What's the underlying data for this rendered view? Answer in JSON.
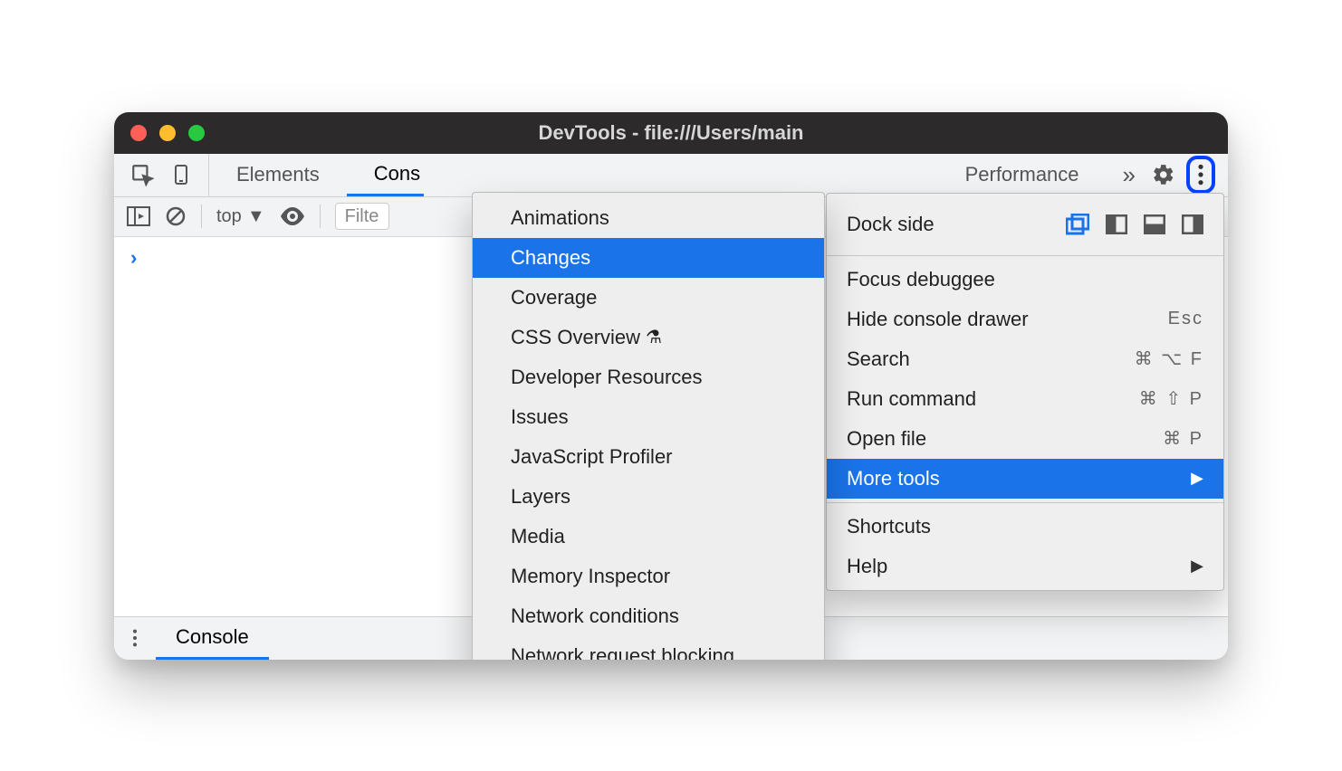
{
  "titlebar": {
    "title": "DevTools - file:///Users/main"
  },
  "tabs": {
    "elements": "Elements",
    "console_truncated": "Cons",
    "performance_truncated": "Performance"
  },
  "console_toolbar": {
    "context": "top",
    "filter_placeholder": "Filte"
  },
  "console": {
    "prompt": "›"
  },
  "drawer": {
    "tab": "Console"
  },
  "menu": {
    "dock_label": "Dock side",
    "focus": "Focus debuggee",
    "hide_drawer": {
      "label": "Hide console drawer",
      "shortcut": "Esc"
    },
    "search": {
      "label": "Search",
      "shortcut": "⌘ ⌥ F"
    },
    "run_command": {
      "label": "Run command",
      "shortcut": "⌘ ⇧ P"
    },
    "open_file": {
      "label": "Open file",
      "shortcut": "⌘ P"
    },
    "more_tools": "More tools",
    "shortcuts": "Shortcuts",
    "help": "Help"
  },
  "submenu": {
    "items": [
      {
        "label": "Animations"
      },
      {
        "label": "Changes",
        "hover": true
      },
      {
        "label": "Coverage"
      },
      {
        "label": "CSS Overview",
        "experimental": true
      },
      {
        "label": "Developer Resources"
      },
      {
        "label": "Issues"
      },
      {
        "label": "JavaScript Profiler"
      },
      {
        "label": "Layers"
      },
      {
        "label": "Media"
      },
      {
        "label": "Memory Inspector"
      },
      {
        "label": "Network conditions"
      },
      {
        "label": "Network request blocking"
      }
    ]
  },
  "colors": {
    "accent": "#1a73e8",
    "highlight_ring": "#0742ff"
  }
}
